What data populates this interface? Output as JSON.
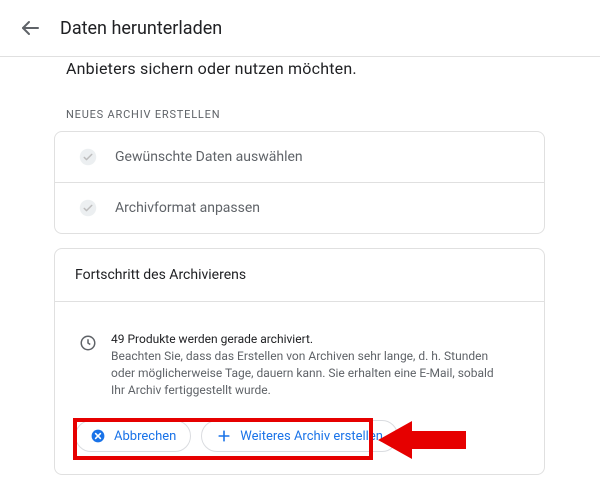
{
  "header": {
    "title": "Daten herunterladen",
    "partial_line": "Anbieters sichern oder nutzen möchten."
  },
  "new_archive": {
    "section_label": "NEUES ARCHIV ERSTELLEN",
    "step1": "Gewünschte Daten auswählen",
    "step2": "Archivformat anpassen"
  },
  "progress": {
    "heading": "Fortschritt des Archivierens",
    "status_line": "49 Produkte werden gerade archiviert.",
    "status_note": "Beachten Sie, dass das Erstellen von Archiven sehr lange, d. h. Stunden oder möglicherweise Tage, dauern kann. Sie erhalten eine E-Mail, sobald Ihr Archiv fertiggestellt wurde.",
    "cancel_label": "Abbrechen",
    "another_label": "Weiteres Archiv erstellen"
  }
}
